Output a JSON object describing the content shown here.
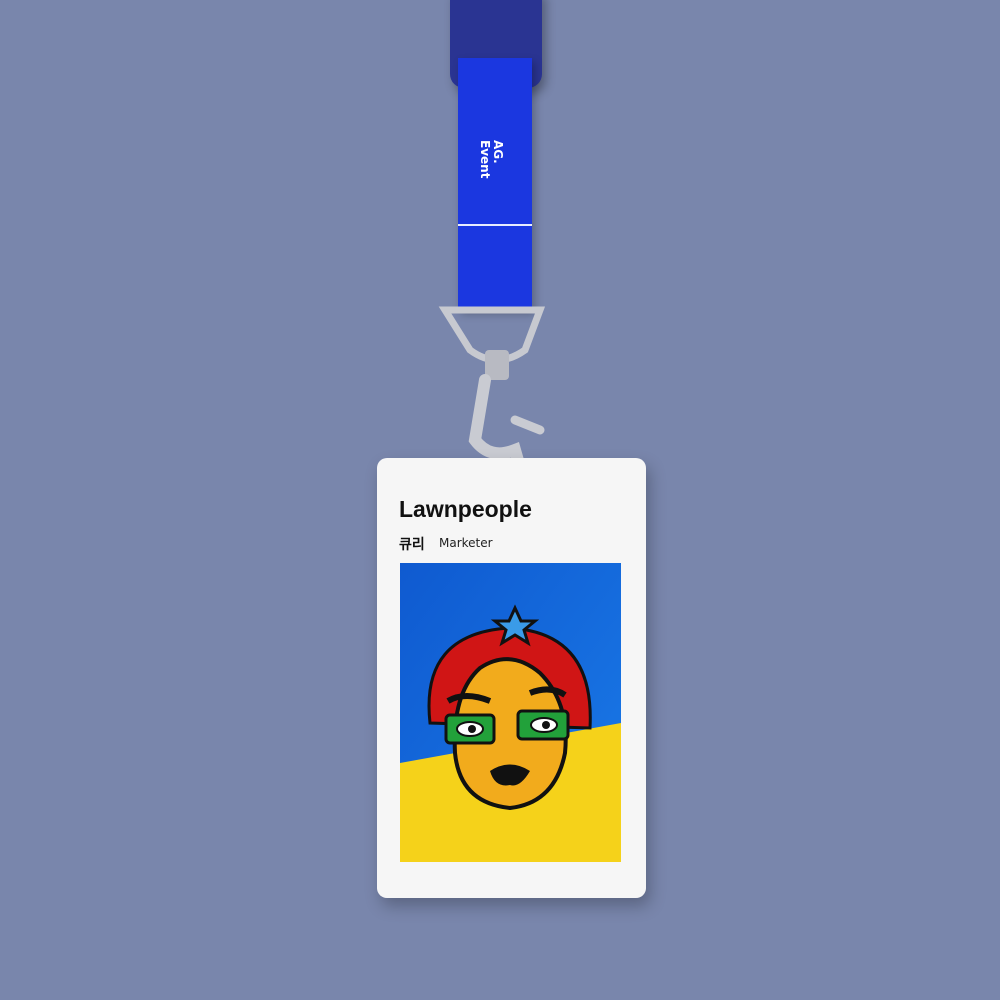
{
  "lanyard": {
    "text_line1": "AG.",
    "text_line2": "Event",
    "color": "#1b37e0"
  },
  "badge": {
    "organization": "Lawnpeople",
    "name": "큐리",
    "role": "Marketer"
  },
  "colors": {
    "background": "#7986ac",
    "art_top": "#1666d6",
    "art_bottom": "#f5d21a",
    "hair": "#d01515",
    "glasses": "#22a13a"
  }
}
